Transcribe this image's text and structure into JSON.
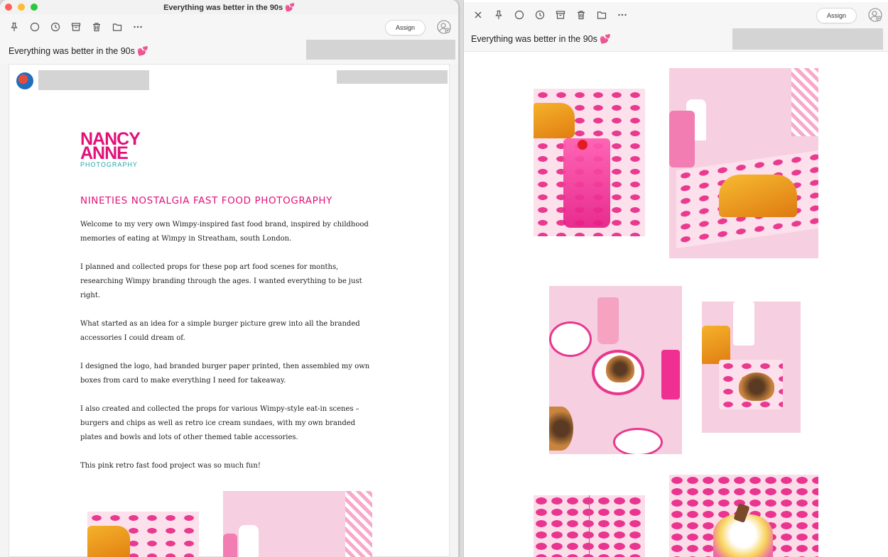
{
  "left_window": {
    "title": "Everything was better in the 90s 💕",
    "subject": "Everything was better in the 90s 💕",
    "assign_label": "Assign",
    "logo": {
      "line1": "NANCY",
      "line2": "ANNE",
      "line3": "PHOTOGRAPHY"
    },
    "article": {
      "heading": "NINETIES NOSTALGIA FAST FOOD PHOTOGRAPHY",
      "paragraphs": [
        "Welcome to my very own Wimpy-inspired fast food brand, inspired by childhood memories of eating at Wimpy in Streatham, south London.",
        "I planned and collected props for these pop art food scenes for months, researching Wimpy branding through the ages. I wanted everything to be just right.",
        "What started as an idea for a simple burger picture grew into all the branded accessories I could dream of.",
        "I designed the logo, had branded burger paper printed, then assembled my own boxes from card to make everything I need for takeaway.",
        "I also created and collected the props for various Wimpy-style eat-in scenes – burgers and chips as well as retro ice cream sundaes, with my own branded plates and bowls and lots of other themed table accessories.",
        "This pink retro fast food project was so much fun!"
      ]
    }
  },
  "right_window": {
    "subject": "Everything was better in the 90s 💕",
    "assign_label": "Assign"
  },
  "colors": {
    "brand_pink": "#e2117a",
    "brand_teal": "#1aa6a6",
    "photo_pink": "#f6cfe0"
  },
  "icons": [
    "close-icon",
    "pin-icon",
    "circle-icon",
    "clock-icon",
    "archive-icon",
    "trash-icon",
    "folder-icon",
    "more-icon",
    "user-add-icon"
  ]
}
